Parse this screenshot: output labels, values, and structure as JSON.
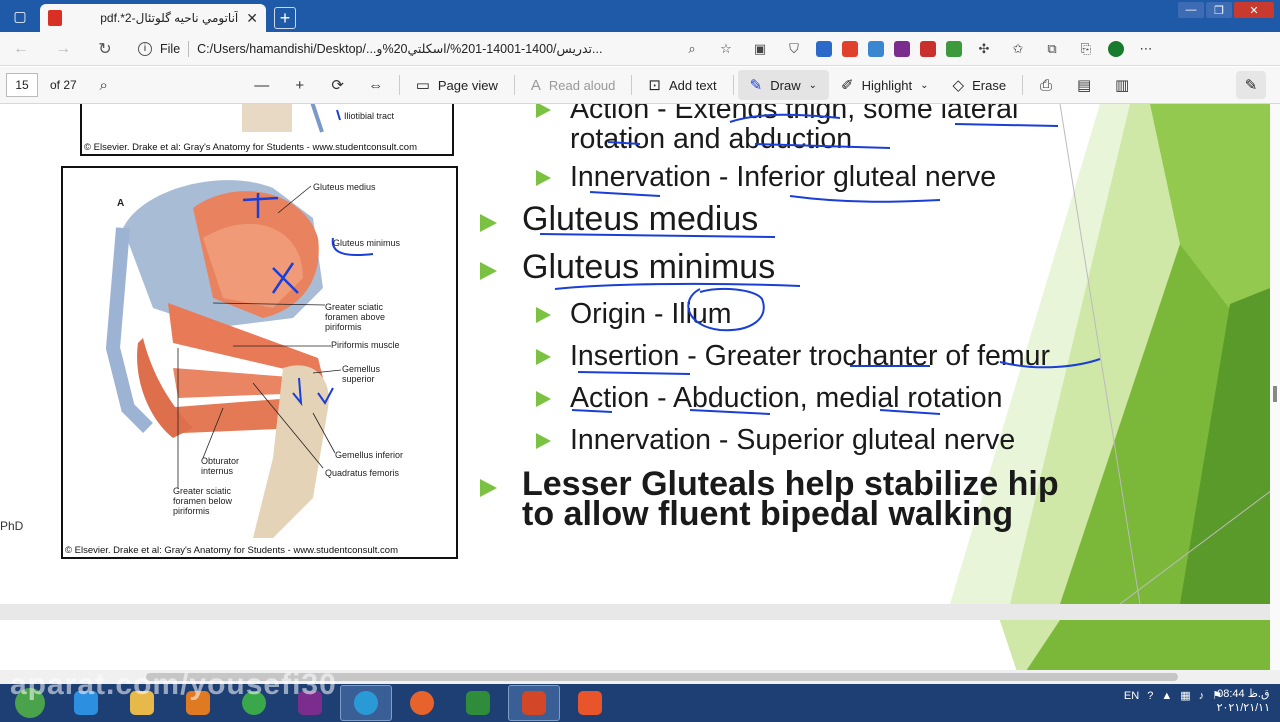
{
  "browser": {
    "tab_title": "pdf.*2-آناتومي ناحيه گلوتئال",
    "tab_close": "✕",
    "new_tab": "+",
    "url_label": "File",
    "url": "C:/Users/hamandishi/Desktop/...تدريس/1400-14001-201%/اسكلتي20%و...",
    "window_buttons": [
      "—",
      "❐",
      "✕"
    ]
  },
  "pdf_toolbar": {
    "page_number": "15",
    "page_total": "of 27",
    "page_view": "Page view",
    "read_aloud": "Read aloud",
    "add_text": "Add text",
    "draw": "Draw",
    "highlight": "Highlight",
    "erase": "Erase"
  },
  "slide": {
    "figure_top_credit": "© Elsevier. Drake et al: Gray's Anatomy for Students - www.studentconsult.com",
    "figure_top_label": "Iliotibial tract",
    "figure_letter": "A",
    "figure_labels": {
      "gluteus_medius": "Gluteus medius",
      "gluteus_minimus": "Gluteus minimus",
      "greater_sciatic_above": "Greater sciatic\nforamen above\npiriformis",
      "piriformis": "Piriformis muscle",
      "gemellus_superior": "Gemellus\nsuperior",
      "obturator_internus": "Obturator\ninternus",
      "gemellus_inferior": "Gemellus inferior",
      "greater_sciatic_below": "Greater sciatic\nforamen below\npiriformis",
      "quadratus_femoris": "Quadratus femoris"
    },
    "figure_credit": "© Elsevier. Drake et al: Gray's Anatomy for Students - www.studentconsult.com",
    "side_text": "PhD",
    "bullets": {
      "action_prev_1": "Action - Extends thigh, some lateral",
      "action_prev_2": "rotation and abduction",
      "innervation_prev": "Innervation - Inferior gluteal nerve",
      "gluteus_medius": "Gluteus medius",
      "gluteus_minimus": "Gluteus minimus",
      "origin": "Origin - Ilium",
      "insertion": "Insertion - Greater trochanter of femur",
      "action": "Action - Abduction, medial rotation",
      "innervation": "Innervation - Superior gluteal nerve",
      "lesser_1": "Lesser Gluteals help stabilize hip",
      "lesser_2": "to allow fluent bipedal walking"
    },
    "slide_number": "15"
  },
  "taskbar": {
    "language": "EN",
    "time": "08:44 ق.ظ",
    "date": "۲۰۲۱/۲۱/۱۱",
    "watermark": "aparat.com/yousefi30"
  },
  "colors": {
    "bullet_green": "#7cc242",
    "ink_blue": "#1a3fd6",
    "tab_blue": "#1e5aa8"
  }
}
